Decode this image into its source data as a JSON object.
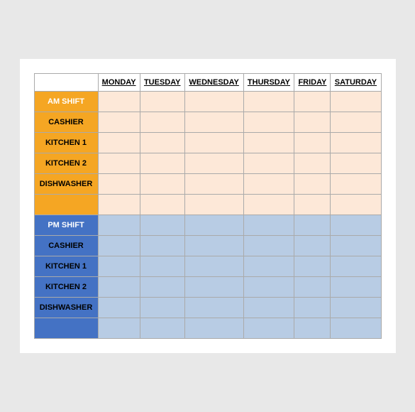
{
  "headers": {
    "col0": "",
    "monday": "MONDAY",
    "tuesday": "TUESDAY",
    "wednesday": "WEDNESDAY",
    "thursday": "THURSDAY",
    "friday": "FRIDAY",
    "saturday": "SATURDAY"
  },
  "am_section": {
    "shift_label": "AM SHIFT",
    "rows": [
      {
        "label": "CASHIER"
      },
      {
        "label": "KITCHEN 1"
      },
      {
        "label": "KITCHEN 2"
      },
      {
        "label": "DISHWASHER"
      },
      {
        "label": ""
      }
    ]
  },
  "pm_section": {
    "shift_label": "PM SHIFT",
    "rows": [
      {
        "label": "CASHIER"
      },
      {
        "label": "KITCHEN 1"
      },
      {
        "label": "KITCHEN 2"
      },
      {
        "label": "DISHWASHER"
      },
      {
        "label": ""
      }
    ]
  }
}
